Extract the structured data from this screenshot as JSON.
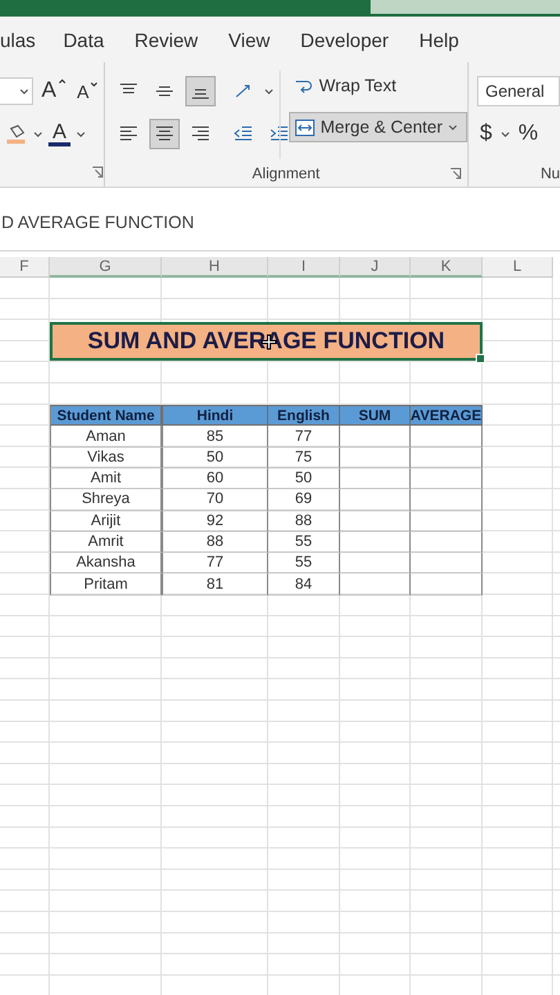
{
  "ribbon_tabs": [
    {
      "label": "ulas",
      "selected": false
    },
    {
      "label": "Data",
      "selected": false
    },
    {
      "label": "Review",
      "selected": false
    },
    {
      "label": "View",
      "selected": false
    },
    {
      "label": "Developer",
      "selected": false
    },
    {
      "label": "Help",
      "selected": false
    }
  ],
  "font_group": {
    "grow_label": "A",
    "shrink_label": "A",
    "font_color_label": "A"
  },
  "alignment_group": {
    "label": "Alignment",
    "row_1": [
      {
        "kind": "align-top",
        "selected": false
      },
      {
        "kind": "align-middle",
        "selected": false
      },
      {
        "kind": "align-bottom",
        "selected": true
      },
      {
        "kind": "orientation",
        "selected": false
      }
    ],
    "row_2": [
      {
        "kind": "align-left",
        "selected": false
      },
      {
        "kind": "align-center",
        "selected": true
      },
      {
        "kind": "align-right",
        "selected": false
      },
      {
        "kind": "indent-decrease",
        "selected": false
      },
      {
        "kind": "indent-increase",
        "selected": false
      }
    ],
    "wrap_text": {
      "label": "Wrap Text",
      "selected": false
    },
    "merge_center": {
      "label": "Merge & Center",
      "selected": true
    }
  },
  "number_group": {
    "format": "General",
    "currency": "$",
    "percent": "%",
    "label": "Nu"
  },
  "formula_bar": {
    "value": "D AVERAGE FUNCTION"
  },
  "column_headers": [
    "F",
    "G",
    "H",
    "I",
    "J",
    "K",
    "L"
  ],
  "title_cell": {
    "text": "SUM AND AVERAGE FUNCTION",
    "selected": true
  },
  "table": {
    "columns": [
      "Student Name",
      "Hindi",
      "English",
      "SUM",
      "AVERAGE"
    ],
    "rows": [
      [
        "Aman",
        "85",
        "77"
      ],
      [
        "Vikas",
        "50",
        "75"
      ],
      [
        "Amit",
        "60",
        "50"
      ],
      [
        "Shreya",
        "70",
        "69"
      ],
      [
        "Arijit",
        "92",
        "88"
      ],
      [
        "Amrit",
        "88",
        "55"
      ],
      [
        "Akansha",
        "77",
        "55"
      ],
      [
        "Pritam",
        "81",
        "84"
      ]
    ]
  }
}
